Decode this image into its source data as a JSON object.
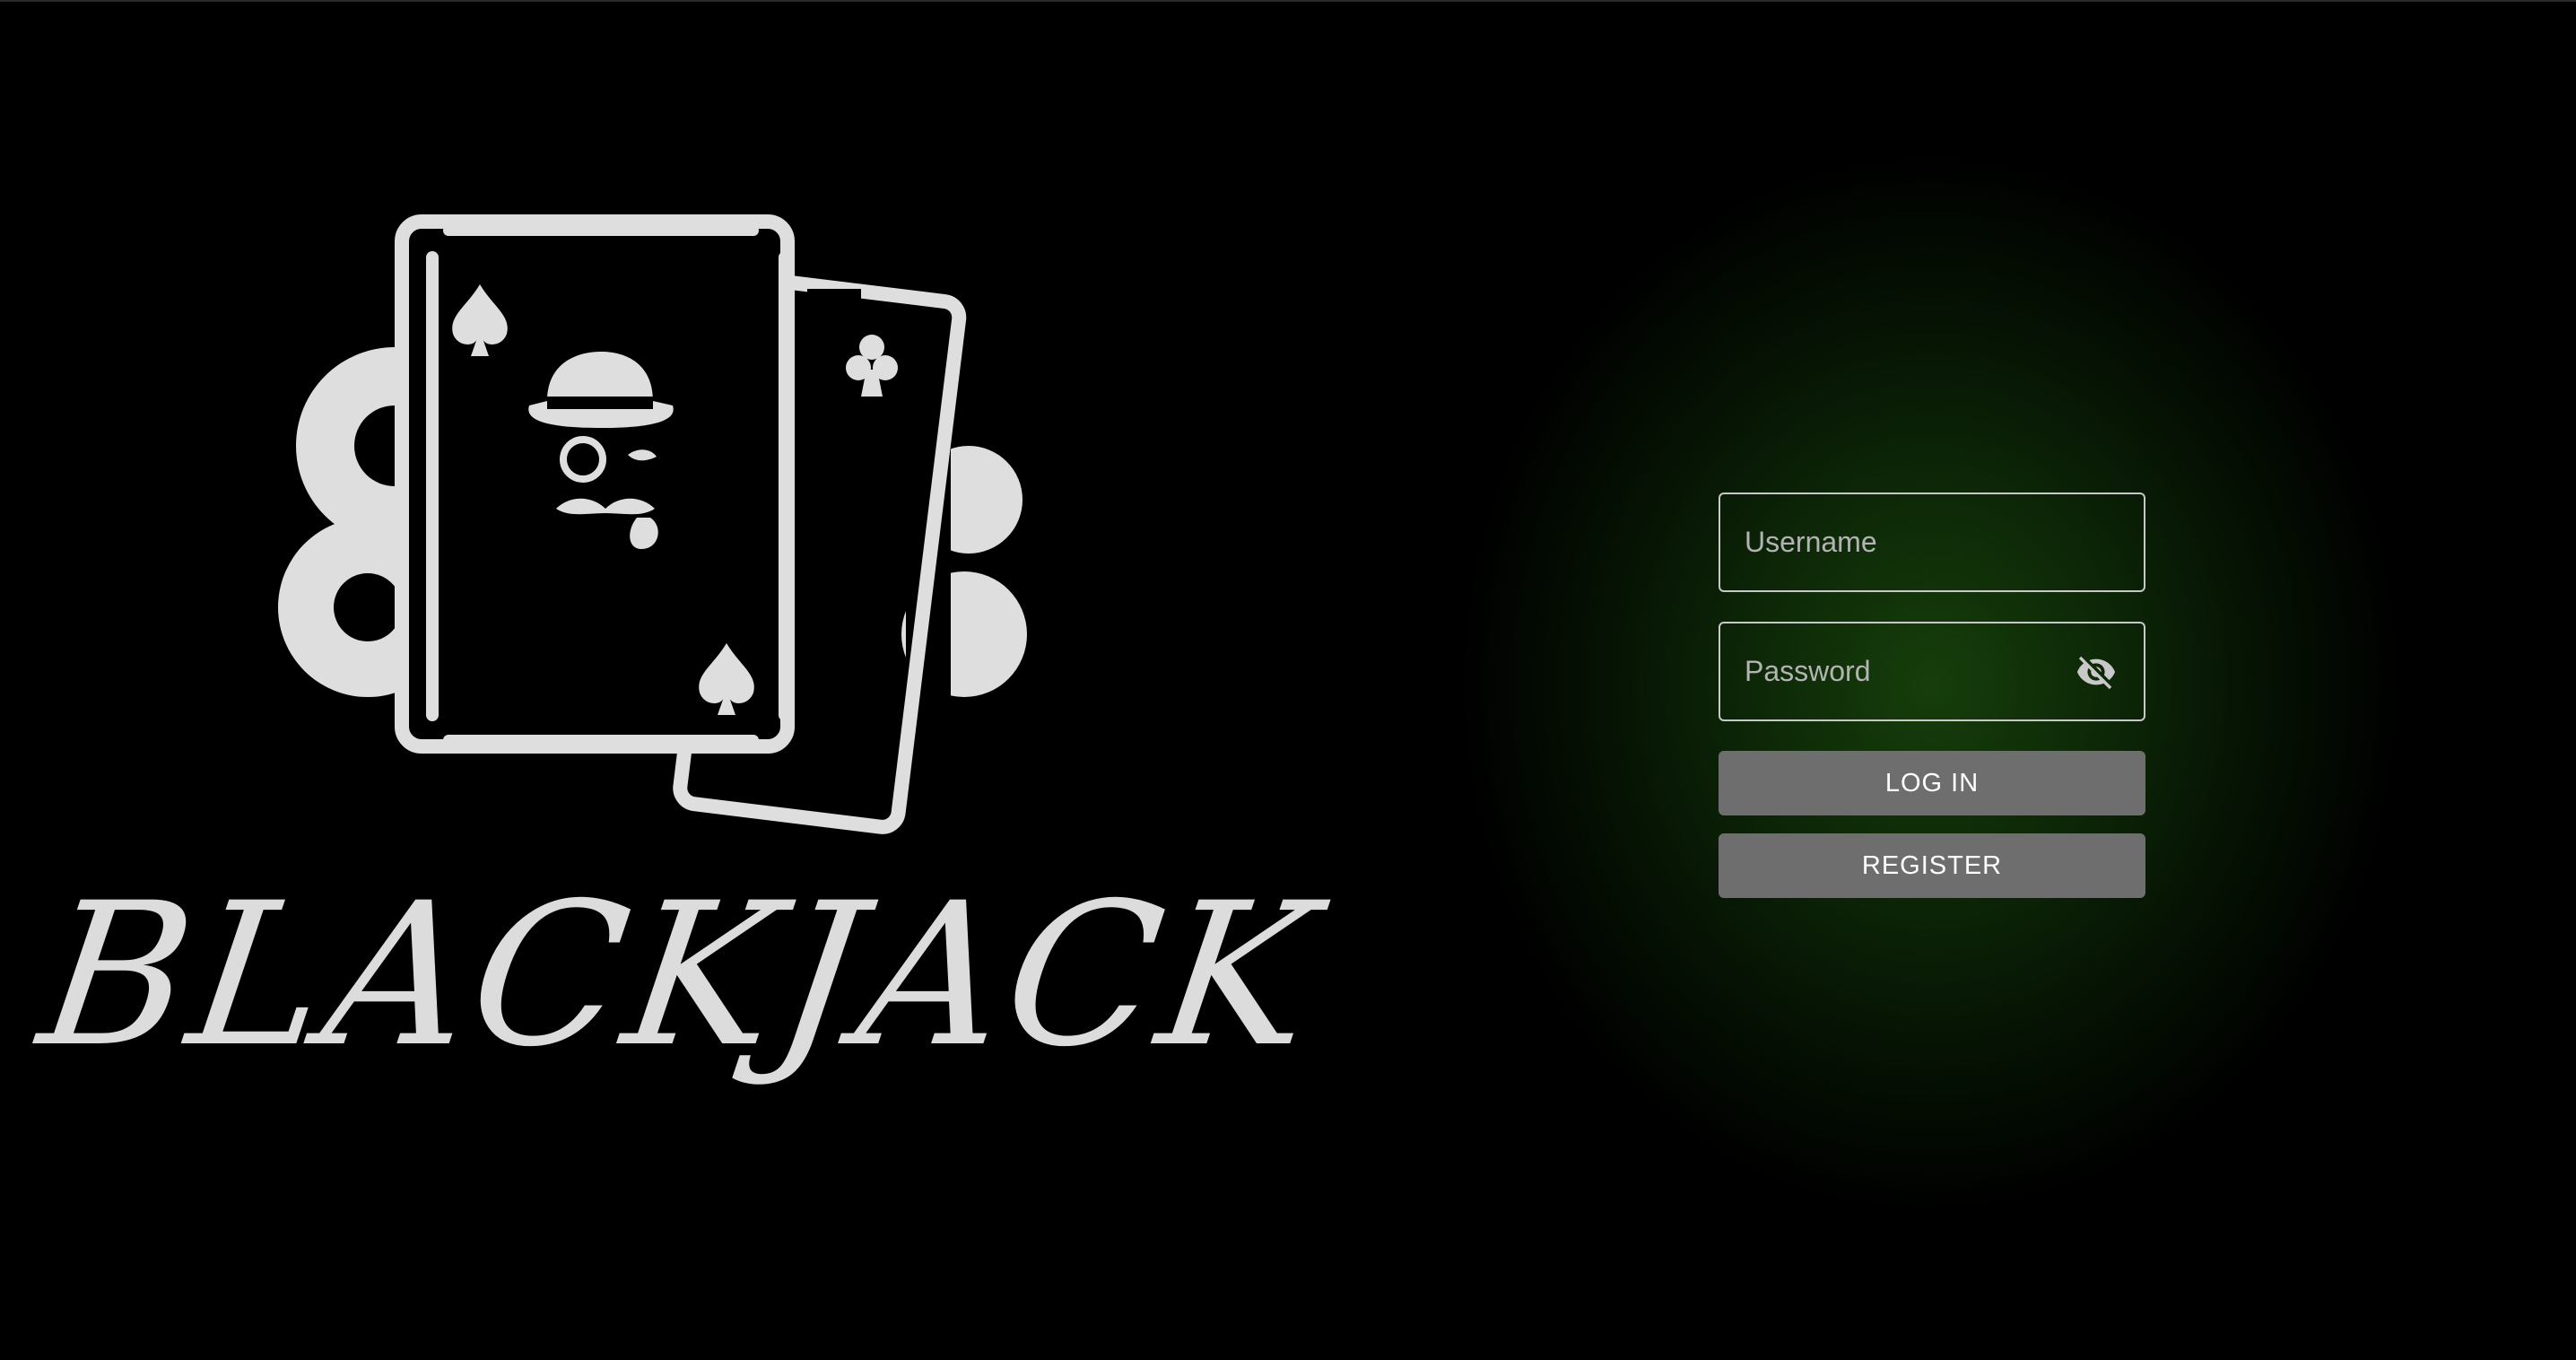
{
  "logo": {
    "wordmark": "BLACKJACK",
    "icon": "playing-cards-gears-gentleman-logo"
  },
  "login": {
    "username": {
      "placeholder": "Username",
      "value": ""
    },
    "password": {
      "placeholder": "Password",
      "value": "",
      "toggle_icon": "eye-off-icon"
    },
    "login_label": "LOG IN",
    "register_label": "REGISTER"
  },
  "colors": {
    "background": "#000000",
    "glow": "#163e0b",
    "button": "#6e6e6e",
    "field_border": "#c8c8c8"
  }
}
